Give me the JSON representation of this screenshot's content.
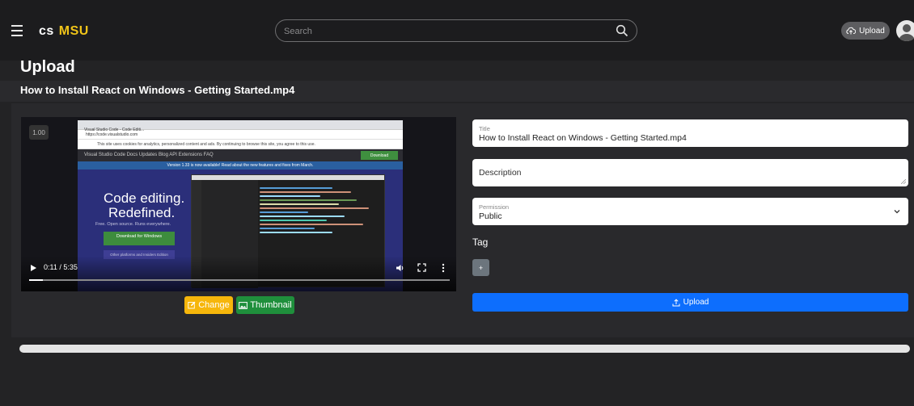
{
  "header": {
    "logo_part1": "cs",
    "logo_part2": "MSU",
    "search_placeholder": "Search",
    "upload_label": "Upload"
  },
  "page": {
    "title": "Upload",
    "file_name": "How to Install React on Windows - Getting Started.mp4"
  },
  "video": {
    "speed": "1.00",
    "time": "0:11 / 5:35",
    "progress": 0.033,
    "frame": {
      "tab": "Visual Studio Code - Code Editi...",
      "url": "https://code.visualstudio.com",
      "notice": "This site uses cookies for analytics, personalized content and ads. By continuing to browse this site, you agree to this use.",
      "nav": "Visual Studio Code   Docs   Updates   Blog   API   Extensions   FAQ",
      "nav_download": "Download",
      "banner": "Version 1.33 is now available! Read about the new features and fixes from March.",
      "headline1": "Code editing.",
      "headline2": "Redefined.",
      "tagline": "Free. Open source. Runs everywhere.",
      "download_windows": "Download for Windows",
      "other_platforms": "Other platforms and Insiders Edition"
    }
  },
  "actions": {
    "change_label": "Change",
    "thumbnail_label": "Thumbnail"
  },
  "form": {
    "title_label": "Title",
    "title_value": "How to Install React on Windows - Getting Started.mp4",
    "description_placeholder": "Description",
    "permission_label": "Permission",
    "permission_value": "Public",
    "tag_label": "Tag",
    "tag_add": "+",
    "upload_label": "Upload"
  },
  "colors": {
    "accent_logo": "#f0c419",
    "upload_button": "#0d6efd",
    "change_button": "#f6b60b",
    "thumbnail_button": "#1f8f3c"
  },
  "icons": [
    "menu-icon",
    "search-icon",
    "cloud-upload-icon",
    "user-avatar-icon",
    "play-icon",
    "volume-icon",
    "fullscreen-icon",
    "more-vertical-icon",
    "edit-icon",
    "image-icon",
    "upload-icon",
    "chevron-down-icon"
  ]
}
